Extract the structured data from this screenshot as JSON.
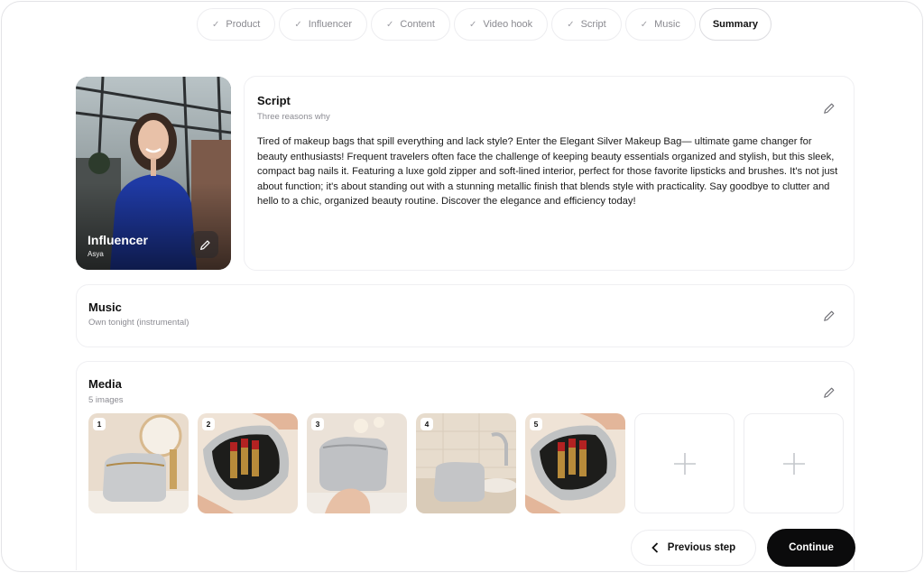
{
  "stepper": {
    "steps": [
      {
        "label": "Product",
        "icon": "check-icon"
      },
      {
        "label": "Influencer",
        "icon": "check-icon"
      },
      {
        "label": "Content",
        "icon": "check-icon"
      },
      {
        "label": "Video hook",
        "icon": "check-icon"
      },
      {
        "label": "Script",
        "icon": "check-icon"
      },
      {
        "label": "Music",
        "icon": "check-icon"
      }
    ],
    "active": "Summary"
  },
  "influencer": {
    "title": "Influencer",
    "name": "Asya"
  },
  "script": {
    "title": "Script",
    "subtitle": "Three reasons why",
    "body": "Tired of makeup bags that spill everything and lack style? Enter the Elegant Silver Makeup Bag— ultimate game changer for beauty enthusiasts! Frequent travelers often face the challenge of keeping beauty essentials organized and stylish, but this sleek, compact bag nails it. Featuring a luxe gold zipper and soft-lined interior, perfect for those favorite lipsticks and brushes. It's not just about function; it's about standing out with a stunning metallic finish that blends style with practicality. Say goodbye to clutter and hello to a chic, organized beauty routine. Discover the elegance and efficiency today!"
  },
  "music": {
    "title": "Music",
    "track": "Own tonight (instrumental)"
  },
  "media": {
    "title": "Media",
    "count_label": "5 images",
    "images": [
      {
        "num": "1",
        "alt": "silver makeup bag on vanity"
      },
      {
        "num": "2",
        "alt": "open bag with lipsticks"
      },
      {
        "num": "3",
        "alt": "hand holding silver bag"
      },
      {
        "num": "4",
        "alt": "silver bag by sink"
      },
      {
        "num": "5",
        "alt": "open bag with lipsticks"
      }
    ]
  },
  "footer": {
    "prev_label": "Previous step",
    "next_label": "Continue"
  },
  "colors": {
    "accent": "#0b0b0c",
    "muted": "#8b8b92",
    "border": "#efeff2"
  }
}
